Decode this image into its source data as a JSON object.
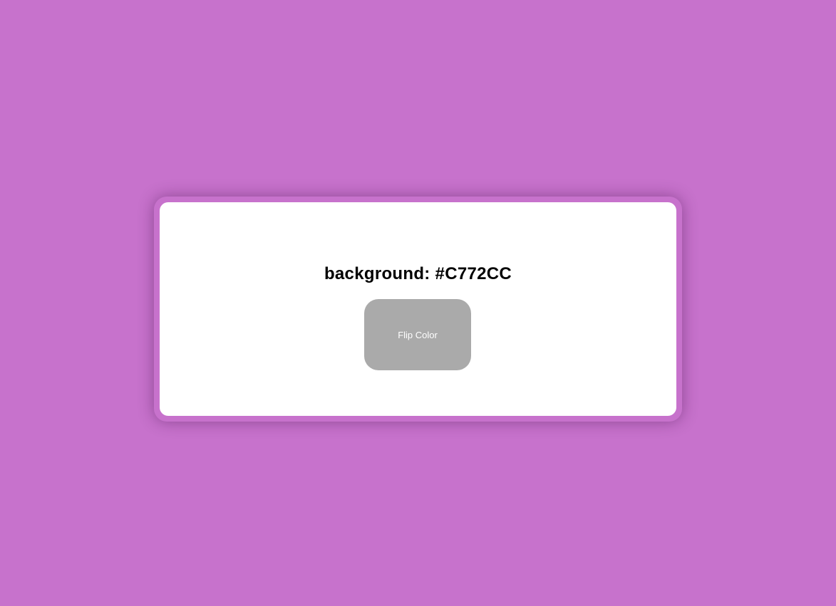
{
  "colors": {
    "page_background": "#C772CC",
    "card_background": "#FFFFFF",
    "button_background": "#AAAAAA",
    "button_text": "#FFFFFF",
    "label_text": "#000000"
  },
  "color_display": {
    "label": "background: #C772CC"
  },
  "flip_button": {
    "label": "Flip Color"
  }
}
